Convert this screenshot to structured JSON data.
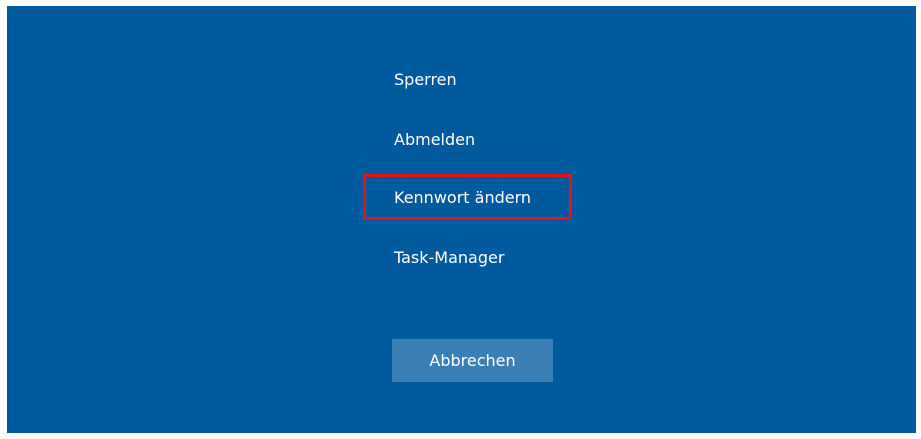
{
  "colors": {
    "background": "#005a9e",
    "text": "#ffffff",
    "cancel_button_bg": "#3a7fb6",
    "highlight_border": "#e8101d"
  },
  "menu": {
    "items": [
      {
        "label": "Sperren"
      },
      {
        "label": "Abmelden"
      },
      {
        "label": "Kennwort ändern",
        "highlighted": true
      },
      {
        "label": "Task-Manager"
      }
    ]
  },
  "cancel": {
    "label": "Abbrechen"
  }
}
